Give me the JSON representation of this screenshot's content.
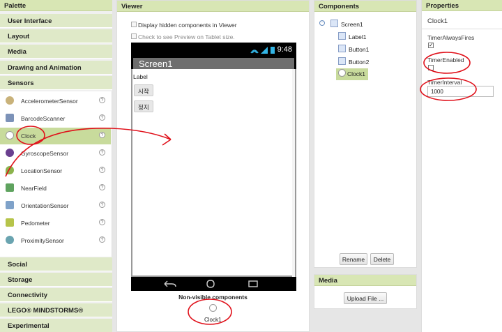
{
  "palette": {
    "title": "Palette",
    "categories_top": [
      "User Interface",
      "Layout",
      "Media",
      "Drawing and Animation",
      "Sensors"
    ],
    "sensor_items": [
      {
        "label": "AccelerometerSensor",
        "icon": "accelerometer-icon",
        "color": "#c9b27a"
      },
      {
        "label": "BarcodeScanner",
        "icon": "barcode-icon",
        "color": "#7c92b8"
      },
      {
        "label": "Clock",
        "icon": "clock-icon",
        "color": "#e8e8e8"
      },
      {
        "label": "GyroscopeSensor",
        "icon": "gyroscope-icon",
        "color": "#6a3f8f"
      },
      {
        "label": "LocationSensor",
        "icon": "location-icon",
        "color": "#8bb34c"
      },
      {
        "label": "NearField",
        "icon": "nearfield-icon",
        "color": "#5fa35f"
      },
      {
        "label": "OrientationSensor",
        "icon": "orientation-icon",
        "color": "#7fa2c9"
      },
      {
        "label": "Pedometer",
        "icon": "pedometer-icon",
        "color": "#b6c44a"
      },
      {
        "label": "ProximitySensor",
        "icon": "proximity-icon",
        "color": "#6aa4b0"
      }
    ],
    "help_symbol": "?",
    "categories_bottom": [
      "Social",
      "Storage",
      "Connectivity",
      "LEGO® MINDSTORMS®",
      "Experimental"
    ]
  },
  "viewer": {
    "title": "Viewer",
    "option_hidden": "Display hidden components in Viewer",
    "option_tablet": "Check to see Preview on Tablet size.",
    "status_time": "9:48",
    "screen_title": "Screen1",
    "label_text": "Label",
    "button1_text": "시작",
    "button2_text": "정지",
    "nonvisible_title": "Non-visible components",
    "nonvisible_item": "Clock1"
  },
  "components": {
    "title": "Components",
    "tree": [
      "Screen1",
      "Label1",
      "Button1",
      "Button2",
      "Clock1"
    ],
    "rename_label": "Rename",
    "delete_label": "Delete"
  },
  "media": {
    "title": "Media",
    "upload_label": "Upload File ..."
  },
  "properties": {
    "title": "Properties",
    "component_name": "Clock1",
    "timer_always_fires_label": "TimerAlwaysFires",
    "timer_always_fires_checked": true,
    "timer_enabled_label": "TimerEnabled",
    "timer_enabled_checked": false,
    "timer_interval_label": "TimerInterval",
    "timer_interval_value": "1000"
  },
  "colors": {
    "header_green": "#d8e6b4",
    "selected_green": "#c8db9c",
    "annotation_red": "#e0101a"
  }
}
